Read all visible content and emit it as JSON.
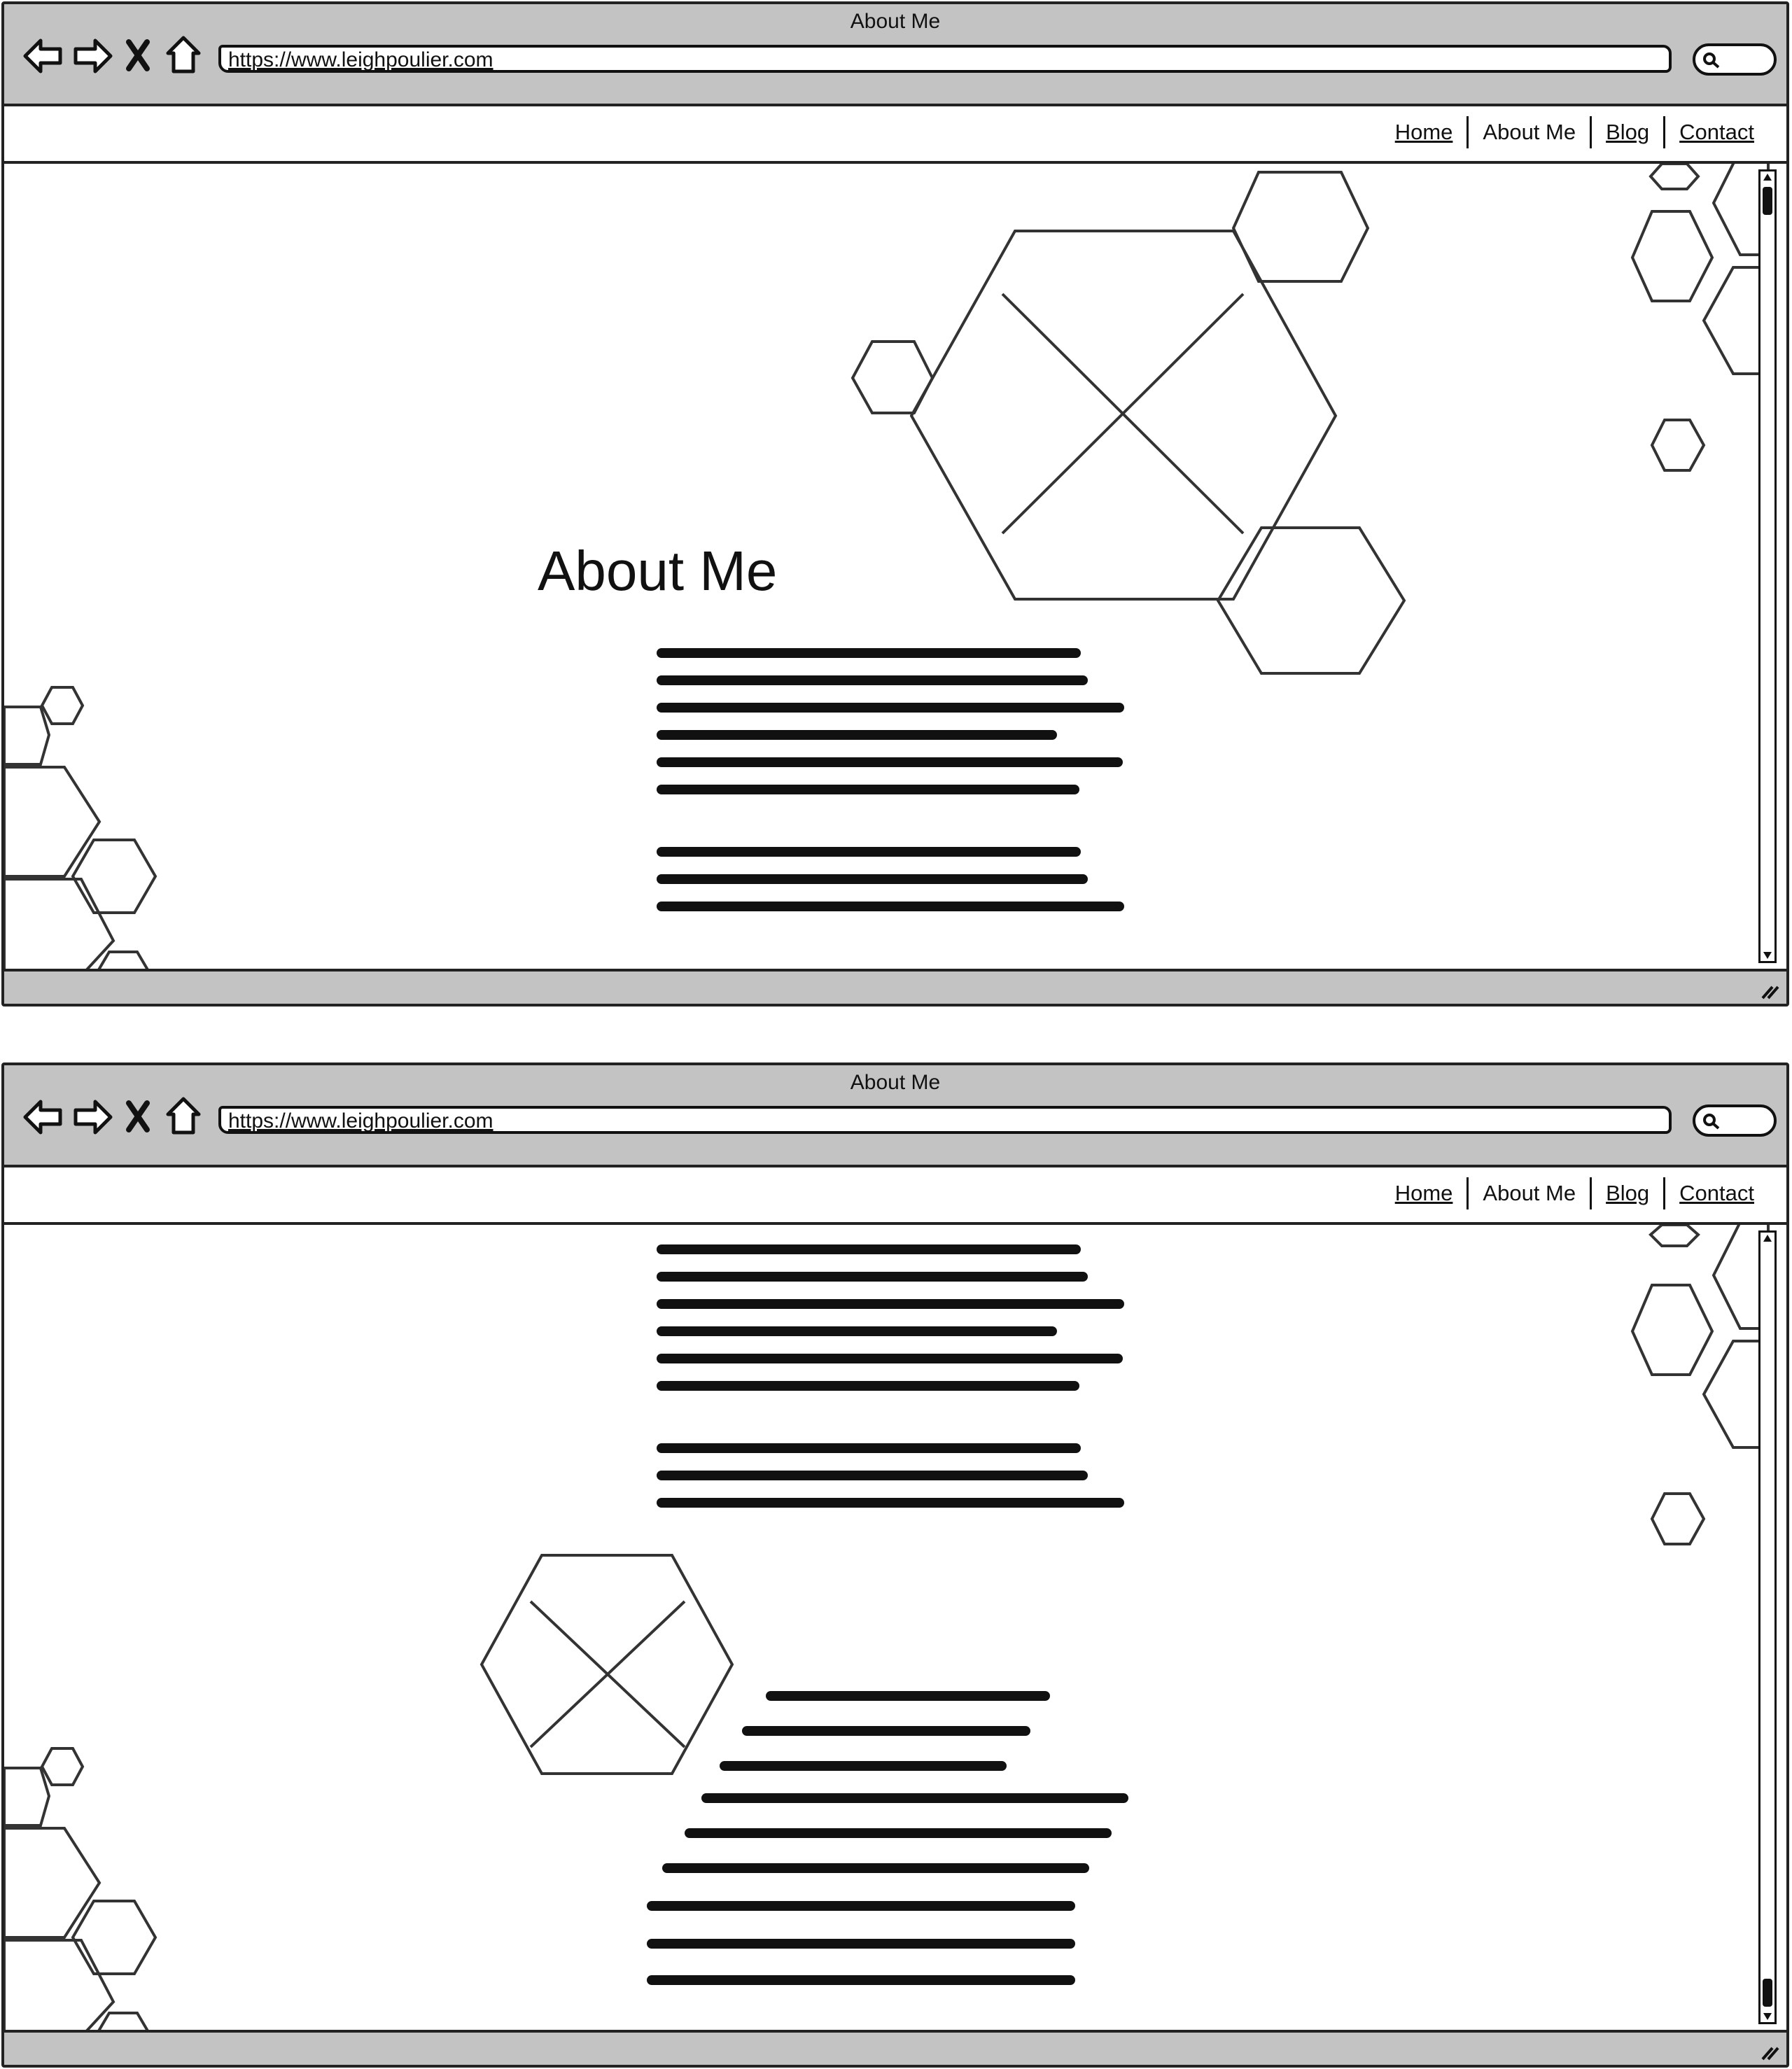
{
  "browser": {
    "window_title": "About Me",
    "url": "https://www.leighpoulier.com"
  },
  "nav": {
    "home": "Home",
    "about": "About Me",
    "blog": "Blog",
    "contact": "Contact"
  },
  "page": {
    "heading": "About Me"
  },
  "icons": {
    "back": "back-arrow-icon",
    "forward": "forward-arrow-icon",
    "stop": "close-icon",
    "home": "home-icon",
    "search": "search-icon",
    "image_placeholder": "image-placeholder-icon",
    "resize_grip": "resize-grip-icon"
  },
  "colors": {
    "chrome": "#c3c3c3",
    "ink": "#111111",
    "background": "#ffffff"
  }
}
